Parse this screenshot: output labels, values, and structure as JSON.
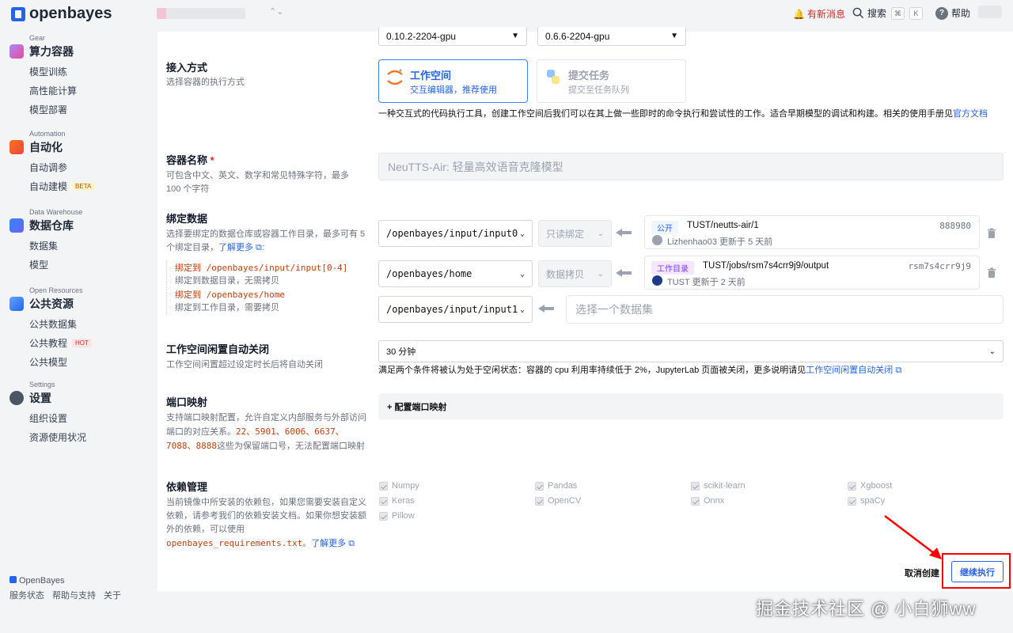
{
  "app": {
    "logo_text": "openbayes"
  },
  "topbar": {
    "news_label": "有新消息",
    "search_label": "搜索",
    "kbd_cmd": "⌘",
    "kbd_k": "K",
    "help_label": "帮助"
  },
  "sidebar": {
    "sections": [
      {
        "caption": "Gear",
        "title": "算力容器",
        "items": [
          "模型训练",
          "高性能计算",
          "模型部署"
        ]
      },
      {
        "caption": "Automation",
        "title": "自动化",
        "items": [
          "自动调参",
          "自动建模"
        ],
        "badge": "BETA"
      },
      {
        "caption": "Data Warehouse",
        "title": "数据仓库",
        "items": [
          "数据集",
          "模型"
        ]
      },
      {
        "caption": "Open Resources",
        "title": "公共资源",
        "items": [
          "公共数据集",
          "公共教程",
          "公共模型"
        ],
        "badge": "HOT"
      },
      {
        "caption": "Settings",
        "title": "设置",
        "items": [
          "组织设置",
          "资源使用状况"
        ]
      }
    ],
    "footer": {
      "brand": "OpenBayes",
      "links": [
        "服务状态",
        "帮助与支持",
        "关于"
      ]
    }
  },
  "form": {
    "top_selects": [
      "0.10.2-2204-gpu",
      "0.6.6-2204-gpu"
    ],
    "access": {
      "label": "接入方式",
      "desc": "选择容器的执行方式",
      "workspace_title": "工作空间",
      "workspace_sub": "交互编辑器，推荐使用",
      "task_title": "提交任务",
      "task_sub": "提交至任务队列",
      "note": "一种交互式的代码执行工具，创建工作空间后我们可以在其上做一些即时的命令执行和尝试性的工作。适合早期模型的调试和构建。相关的使用手册见",
      "note_link": "官方文档"
    },
    "name": {
      "label": "容器名称",
      "required": "*",
      "desc": "可包含中文、英文、数字和常见特殊字符，最多 100 个字符",
      "placeholder": "NeuTTS-Air: 轻量高效语音克隆模型"
    },
    "bind": {
      "label": "绑定数据",
      "desc": "选择要绑定的数据仓库或容器工作目录，最多可有 5 个绑定目录，",
      "learn_more": "了解更多",
      "hint1_code": "绑定到 /openbayes/input/input[0-4]",
      "hint1_text": "绑定到数据目录，无需拷贝",
      "hint2_code": "绑定到 /openbayes/home",
      "hint2_text": "绑定到工作目录，需要拷贝",
      "rows": [
        {
          "path": "/openbayes/input/input0",
          "mode": "只读绑定",
          "tag": "公开",
          "source": "TUST/neutts-air/1",
          "id": "888980",
          "meta": "Lizhenhao03 更新于 5 天前"
        },
        {
          "path": "/openbayes/home",
          "mode": "数据拷贝",
          "tag": "工作目录",
          "source": "TUST/jobs/rsm7s4crr9j9/output",
          "id": "rsm7s4crr9j9",
          "meta": "TUST 更新于 2 天前"
        },
        {
          "path": "/openbayes/input/input1",
          "placeholder": "选择一个数据集"
        }
      ]
    },
    "idle": {
      "label": "工作空间闲置自动关闭",
      "desc": "工作空间闲置超过设定时长后将自动关闭",
      "value": "30 分钟",
      "note": "满足两个条件将被认为处于空闲状态：容器的 cpu 利用率持续低于 2%，JupyterLab 页面被关闭，更多说明请见",
      "note_link": "工作空间闲置自动关闭"
    },
    "ports": {
      "label": "端口映射",
      "desc_a": "支持端口映射配置，允许自定义内部服务与外部访问端口的对应关系。",
      "reserved": "22、5901、6006、6637、7088、8888",
      "desc_b": "这些为保留端口号，无法配置端口映射",
      "button": "+ 配置端口映射"
    },
    "deps": {
      "label": "依赖管理",
      "desc": "当前镜像中所安装的依赖包，如果您需要安装自定义依赖，请参考我们的依赖安装文档。如果你想安装额外的依赖，可以使用",
      "file": "openbayes_requirements.txt",
      "learn_more": "了解更多",
      "packages": [
        "Numpy",
        "Pandas",
        "scikit-learn",
        "Xgboost",
        "Keras",
        "OpenCV",
        "Onnx",
        "spaCy",
        "Pillow"
      ]
    },
    "actions": {
      "cancel": "取消创建",
      "continue": "继续执行"
    }
  },
  "watermark": "掘金技术社区 @ 小白狮ww",
  "colors": {
    "accent": "#2563eb",
    "alert": "#dc2626",
    "highlight_box": "#ff0000"
  }
}
